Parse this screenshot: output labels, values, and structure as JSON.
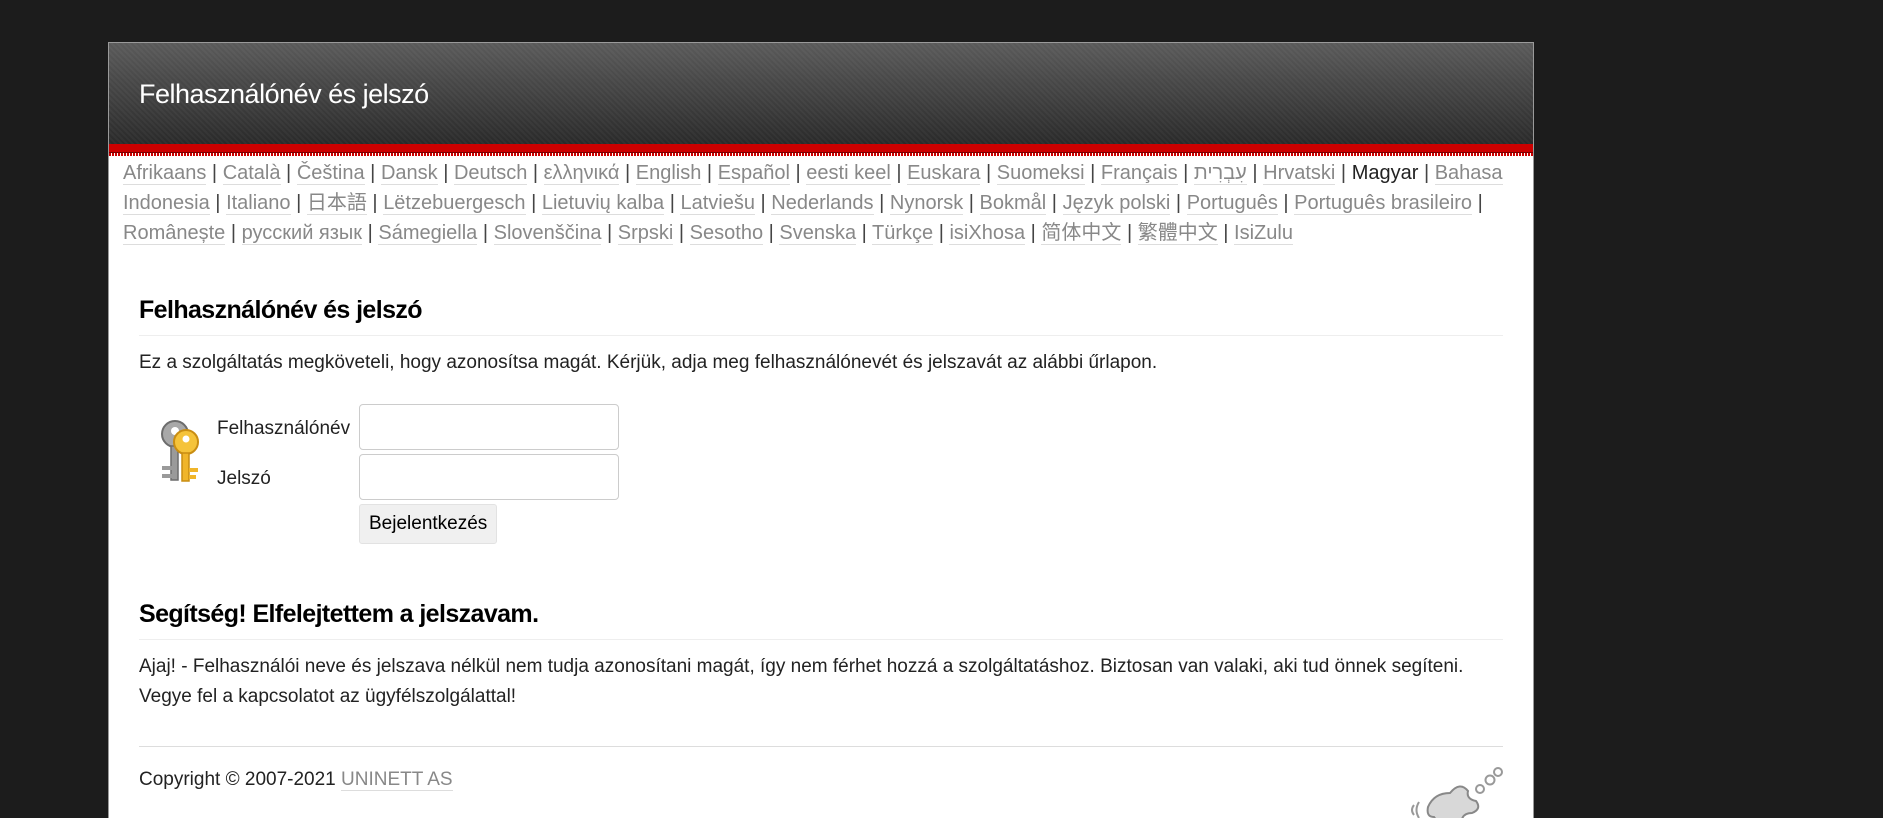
{
  "header": {
    "title": "Felhasználónév és jelszó"
  },
  "languages": [
    {
      "label": "Afrikaans",
      "current": false
    },
    {
      "label": "Català",
      "current": false
    },
    {
      "label": "Čeština",
      "current": false
    },
    {
      "label": "Dansk",
      "current": false
    },
    {
      "label": "Deutsch",
      "current": false
    },
    {
      "label": "ελληνικά",
      "current": false
    },
    {
      "label": "English",
      "current": false
    },
    {
      "label": "Español",
      "current": false
    },
    {
      "label": "eesti keel",
      "current": false
    },
    {
      "label": "Euskara",
      "current": false
    },
    {
      "label": "Suomeksi",
      "current": false
    },
    {
      "label": "Français",
      "current": false
    },
    {
      "label": "עִבְרִית",
      "current": false
    },
    {
      "label": "Hrvatski",
      "current": false
    },
    {
      "label": "Magyar",
      "current": true
    },
    {
      "label": "Bahasa Indonesia",
      "current": false
    },
    {
      "label": "Italiano",
      "current": false
    },
    {
      "label": "日本語",
      "current": false
    },
    {
      "label": "Lëtzebuergesch",
      "current": false
    },
    {
      "label": "Lietuvių kalba",
      "current": false
    },
    {
      "label": "Latviešu",
      "current": false
    },
    {
      "label": "Nederlands",
      "current": false
    },
    {
      "label": "Nynorsk",
      "current": false
    },
    {
      "label": "Bokmål",
      "current": false
    },
    {
      "label": "Język polski",
      "current": false
    },
    {
      "label": "Português",
      "current": false
    },
    {
      "label": "Português brasileiro",
      "current": false
    },
    {
      "label": "Românește",
      "current": false
    },
    {
      "label": "русский язык",
      "current": false
    },
    {
      "label": "Sámegiella",
      "current": false
    },
    {
      "label": "Slovenščina",
      "current": false
    },
    {
      "label": "Srpski",
      "current": false
    },
    {
      "label": "Sesotho",
      "current": false
    },
    {
      "label": "Svenska",
      "current": false
    },
    {
      "label": "Türkçe",
      "current": false
    },
    {
      "label": "isiXhosa",
      "current": false
    },
    {
      "label": "简体中文",
      "current": false
    },
    {
      "label": "繁體中文",
      "current": false
    },
    {
      "label": "IsiZulu",
      "current": false
    }
  ],
  "login": {
    "heading": "Felhasználónév és jelszó",
    "intro": "Ez a szolgáltatás megköveteli, hogy azonosítsa magát. Kérjük, adja meg felhasználónevét és jelszavát az alábbi űrlapon.",
    "username_label": "Felhasználónév",
    "username_value": "",
    "password_label": "Jelszó",
    "password_value": "",
    "submit_label": "Bejelentkezés"
  },
  "help": {
    "heading": "Segítség! Elfelejtettem a jelszavam.",
    "text": "Ajaj! - Felhasználói neve és jelszava nélkül nem tudja azonosítani magát, így nem férhet hozzá a szolgáltatáshoz. Biztosan van valaki, aki tud önnek segíteni. Vegye fel a kapcsolatot az ügyfélszolgálattal!"
  },
  "footer": {
    "copyright": "Copyright © 2007-2021",
    "company": "UNINETT AS"
  },
  "colors": {
    "accent_red": "#cc0000",
    "link_gray": "#888888",
    "header_dark": "#2a2a2a"
  }
}
